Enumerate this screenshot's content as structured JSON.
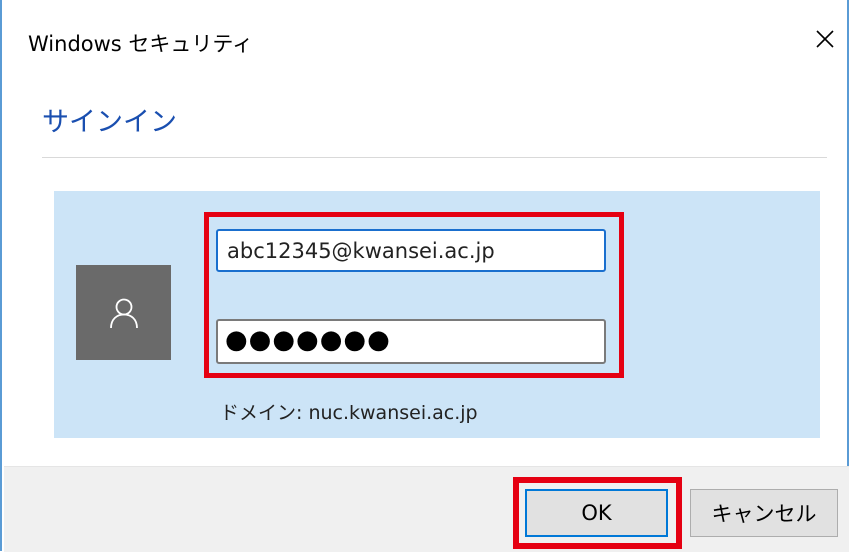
{
  "window": {
    "title": "Windows セキュリティ",
    "close_icon": "close-icon"
  },
  "dialog": {
    "heading": "サインイン"
  },
  "credentials": {
    "avatar_icon": "user-icon",
    "username_value": "abc12345@kwansei.ac.jp",
    "password_value": "●●●●●●●",
    "domain_text": "ドメイン: nuc.kwansei.ac.jp"
  },
  "buttons": {
    "ok_label": "OK",
    "cancel_label": "キャンセル"
  },
  "colors": {
    "accent": "#1a4fb0",
    "panel": "#cce4f7",
    "highlight": "#e50012",
    "focus_border": "#0078d7"
  }
}
